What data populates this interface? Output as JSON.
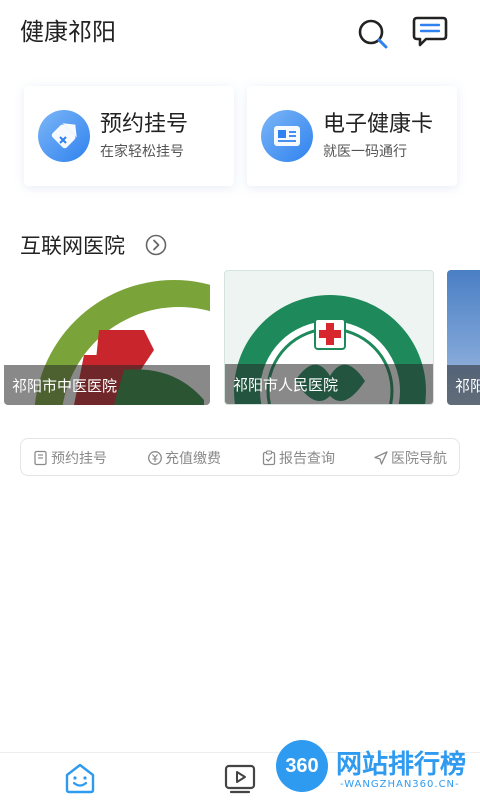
{
  "header": {
    "title": "健康祁阳",
    "search_icon": "search-icon",
    "message_icon": "message-icon"
  },
  "cards": [
    {
      "title": "预约挂号",
      "subtitle": "在家轻松挂号",
      "icon": "ticket-icon"
    },
    {
      "title": "电子健康卡",
      "subtitle": "就医一码通行",
      "icon": "health-card-icon"
    }
  ],
  "section": {
    "title": "互联网医院",
    "arrow_icon": "chevron-right-circle-icon"
  },
  "hospitals": [
    {
      "name": "祁阳市中医医院"
    },
    {
      "name": "祁阳市人民医院",
      "logo_text": "祁阳市人民医院"
    },
    {
      "name": "祁阳"
    }
  ],
  "quick_actions": [
    {
      "label": "预约挂号",
      "icon": "register-icon"
    },
    {
      "label": "充值缴费",
      "icon": "yuan-icon"
    },
    {
      "label": "报告查询",
      "icon": "report-icon"
    },
    {
      "label": "医院导航",
      "icon": "navigation-icon"
    }
  ],
  "tabbar": {
    "items": [
      {
        "icon": "home-smile-icon"
      },
      {
        "icon": "video-icon"
      }
    ]
  },
  "watermark": {
    "badge": "360",
    "title": "网站排行榜",
    "url": "-WANGZHAN360.CN-"
  },
  "colors": {
    "accent": "#2f82ef",
    "watermark": "#2f9bf0"
  }
}
